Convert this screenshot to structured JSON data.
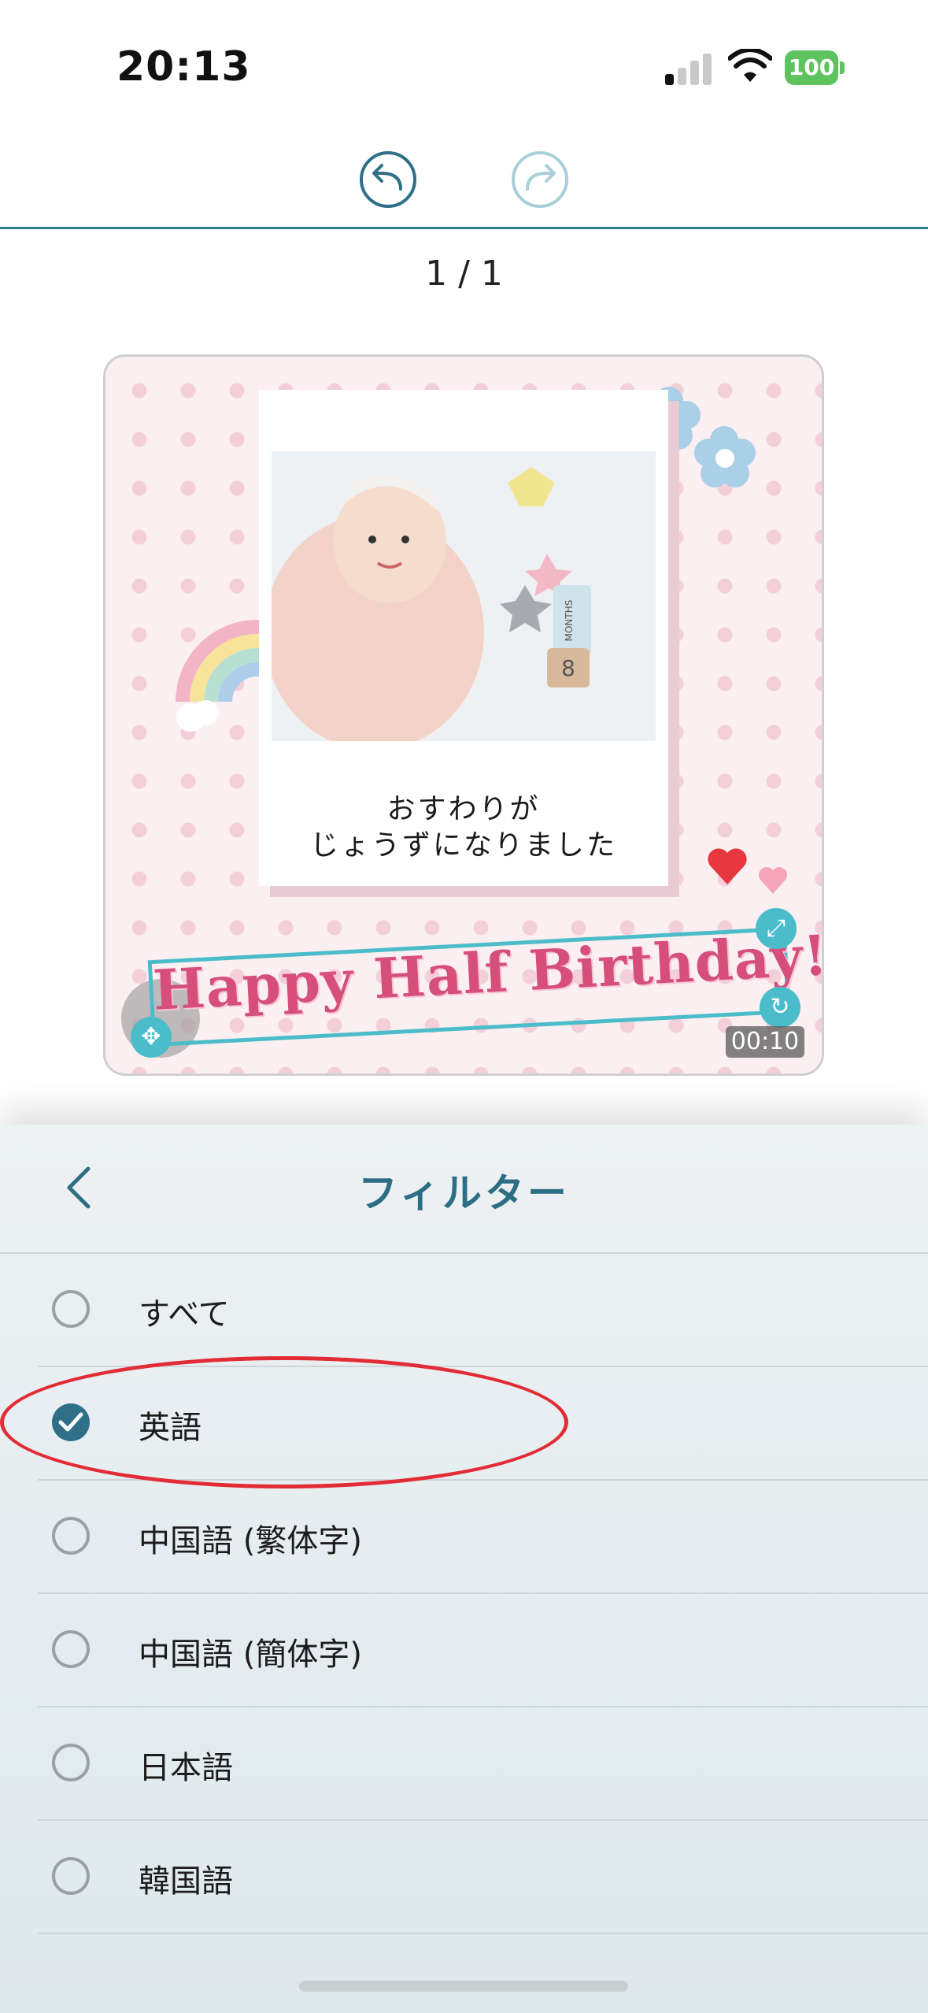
{
  "status_bar": {
    "time": "20:13",
    "battery": "100",
    "signal_icon": "cellular-signal-icon",
    "wifi_icon": "wifi-icon"
  },
  "toolbar": {
    "undo_icon": "undo-arrow-icon",
    "redo_icon": "redo-arrow-icon",
    "accent_color": "#2f7d8a"
  },
  "page_counter": "1 / 1",
  "preview": {
    "caption_line1": "おすわりが",
    "caption_line2": "じょうずになりました",
    "title_text": "Happy Half Birthday!",
    "duration": "00:10",
    "photo_block_text": "MONTHS",
    "photo_block_number": "8"
  },
  "filter_sheet": {
    "title": "フィルター",
    "options": [
      {
        "label": "すべて",
        "checked": false
      },
      {
        "label": "英語",
        "checked": true
      },
      {
        "label": "中国語 (繁体字)",
        "checked": false
      },
      {
        "label": "中国語 (簡体字)",
        "checked": false
      },
      {
        "label": "日本語",
        "checked": false
      },
      {
        "label": "韓国語",
        "checked": false
      }
    ],
    "accent_color": "#2f6f88",
    "highlight_color": "#e12c36"
  }
}
